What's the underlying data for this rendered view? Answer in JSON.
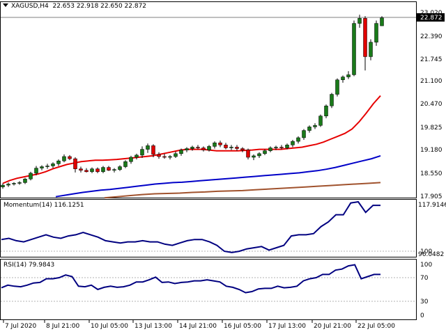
{
  "header": {
    "symbol": "XAGUSD,H4",
    "ohlc": "22.653 22.918 22.650 22.872"
  },
  "colors": {
    "bull": "#1a7a1a",
    "bear": "#e00000",
    "ma_fast": "#e60000",
    "ma_mid": "#0000c8",
    "ma_slow": "#a0522d",
    "momentum": "#000080",
    "rsi": "#000080",
    "level_line": "#c0c0c0",
    "current_price_bg": "#000000"
  },
  "main_panel": {
    "y_ticks": [
      "23.020",
      "22.390",
      "21.745",
      "21.100",
      "20.470",
      "19.825",
      "19.180",
      "18.550",
      "17.905"
    ],
    "current_price_label": "22.872"
  },
  "momentum_panel": {
    "label": "Momentum(14) 116.1251",
    "y_ticks": [
      "117.9146",
      "100",
      "96.0482"
    ]
  },
  "rsi_panel": {
    "label": "RSI(14) 79.9843",
    "y_ticks": [
      "100",
      "70",
      "30",
      "0"
    ]
  },
  "x_axis": {
    "labels": [
      "7 Jul 2020",
      "8 Jul 21:00",
      "10 Jul 05:00",
      "13 Jul 13:00",
      "14 Jul 21:00",
      "16 Jul 05:00",
      "17 Jul 13:00",
      "20 Jul 21:00",
      "22 Jul 05:00"
    ]
  },
  "chart_data": {
    "type": "line",
    "price_scale": [
      17.905,
      23.02
    ],
    "candles": [
      [
        18.2,
        18.3,
        18.15,
        18.25
      ],
      [
        18.25,
        18.32,
        18.2,
        18.28
      ],
      [
        18.28,
        18.33,
        18.24,
        18.3
      ],
      [
        18.3,
        18.36,
        18.26,
        18.32
      ],
      [
        18.32,
        18.45,
        18.28,
        18.42
      ],
      [
        18.42,
        18.62,
        18.38,
        18.58
      ],
      [
        18.58,
        18.78,
        18.52,
        18.72
      ],
      [
        18.72,
        18.8,
        18.66,
        18.76
      ],
      [
        18.76,
        18.84,
        18.7,
        18.78
      ],
      [
        18.78,
        18.88,
        18.72,
        18.84
      ],
      [
        18.84,
        18.96,
        18.78,
        18.92
      ],
      [
        18.92,
        19.1,
        18.88,
        19.04
      ],
      [
        19.04,
        19.08,
        18.94,
        18.98
      ],
      [
        18.98,
        19.02,
        18.6,
        18.7
      ],
      [
        18.7,
        18.76,
        18.6,
        18.66
      ],
      [
        18.66,
        18.72,
        18.6,
        18.62
      ],
      [
        18.62,
        18.74,
        18.58,
        18.7
      ],
      [
        18.7,
        18.74,
        18.58,
        18.62
      ],
      [
        18.62,
        18.78,
        18.58,
        18.74
      ],
      [
        18.74,
        18.78,
        18.64,
        18.66
      ],
      [
        18.66,
        18.72,
        18.6,
        18.68
      ],
      [
        18.68,
        18.8,
        18.64,
        18.76
      ],
      [
        18.76,
        18.94,
        18.72,
        18.9
      ],
      [
        18.9,
        19.06,
        18.84,
        19.02
      ],
      [
        19.02,
        19.12,
        18.96,
        19.08
      ],
      [
        19.08,
        19.32,
        19.0,
        19.24
      ],
      [
        19.24,
        19.4,
        19.14,
        19.34
      ],
      [
        19.34,
        19.38,
        19.02,
        19.1
      ],
      [
        19.1,
        19.16,
        18.98,
        19.04
      ],
      [
        19.04,
        19.12,
        18.98,
        19.02
      ],
      [
        19.02,
        19.08,
        18.96,
        19.04
      ],
      [
        19.04,
        19.18,
        19.0,
        19.12
      ],
      [
        19.12,
        19.26,
        19.06,
        19.22
      ],
      [
        19.22,
        19.3,
        19.16,
        19.26
      ],
      [
        19.26,
        19.34,
        19.2,
        19.3
      ],
      [
        19.3,
        19.36,
        19.24,
        19.28
      ],
      [
        19.28,
        19.32,
        19.18,
        19.22
      ],
      [
        19.22,
        19.36,
        19.18,
        19.32
      ],
      [
        19.32,
        19.46,
        19.26,
        19.42
      ],
      [
        19.42,
        19.48,
        19.3,
        19.36
      ],
      [
        19.36,
        19.42,
        19.24,
        19.28
      ],
      [
        19.28,
        19.36,
        19.22,
        19.3
      ],
      [
        19.3,
        19.36,
        19.2,
        19.26
      ],
      [
        19.26,
        19.3,
        19.16,
        19.22
      ],
      [
        19.22,
        19.26,
        18.96,
        19.02
      ],
      [
        19.02,
        19.1,
        18.94,
        19.06
      ],
      [
        19.06,
        19.16,
        19.0,
        19.12
      ],
      [
        19.12,
        19.24,
        19.08,
        19.2
      ],
      [
        19.2,
        19.32,
        19.16,
        19.28
      ],
      [
        19.28,
        19.34,
        19.22,
        19.3
      ],
      [
        19.3,
        19.36,
        19.24,
        19.28
      ],
      [
        19.28,
        19.4,
        19.24,
        19.36
      ],
      [
        19.36,
        19.5,
        19.3,
        19.46
      ],
      [
        19.46,
        19.6,
        19.4,
        19.56
      ],
      [
        19.56,
        19.8,
        19.5,
        19.76
      ],
      [
        19.76,
        19.9,
        19.7,
        19.86
      ],
      [
        19.86,
        19.96,
        19.8,
        19.9
      ],
      [
        19.9,
        20.2,
        19.86,
        20.16
      ],
      [
        20.16,
        20.48,
        20.1,
        20.44
      ],
      [
        20.44,
        20.8,
        20.38,
        20.76
      ],
      [
        20.76,
        21.2,
        20.7,
        21.16
      ],
      [
        21.16,
        21.28,
        21.08,
        21.24
      ],
      [
        21.24,
        21.4,
        21.18,
        21.3
      ],
      [
        21.3,
        22.8,
        21.26,
        22.72
      ],
      [
        22.72,
        22.96,
        22.6,
        22.86
      ],
      [
        22.86,
        22.92,
        21.42,
        21.8
      ],
      [
        21.8,
        22.28,
        21.7,
        22.2
      ],
      [
        22.2,
        22.8,
        22.1,
        22.72
      ],
      [
        22.653,
        22.918,
        22.65,
        22.872
      ]
    ],
    "ma_fast": [
      18.3,
      18.38,
      18.44,
      18.48,
      18.52,
      18.56,
      18.62,
      18.7,
      18.76,
      18.82,
      18.86,
      18.9,
      18.92,
      18.94,
      18.94,
      18.95,
      18.96,
      18.98,
      19.0,
      19.02,
      19.04,
      19.06,
      19.1,
      19.14,
      19.18,
      19.22,
      19.24,
      19.24,
      19.24,
      19.22,
      19.2,
      19.2,
      19.2,
      19.2,
      19.21,
      19.22,
      19.24,
      19.24,
      19.24,
      19.24,
      19.26,
      19.28,
      19.3,
      19.34,
      19.38,
      19.44,
      19.52,
      19.6,
      19.68,
      19.8,
      20.0,
      20.24,
      20.5,
      20.72
    ],
    "ma_mid": [
      17.93,
      17.97,
      18.01,
      18.05,
      18.08,
      18.11,
      18.13,
      18.16,
      18.19,
      18.22,
      18.25,
      18.28,
      18.3,
      18.32,
      18.33,
      18.35,
      18.37,
      18.39,
      18.41,
      18.43,
      18.45,
      18.47,
      18.49,
      18.51,
      18.53,
      18.55,
      18.57,
      18.59,
      18.62,
      18.65,
      18.69,
      18.74,
      18.8,
      18.86,
      18.92,
      18.98,
      19.06
    ],
    "ma_slow": [
      17.9,
      17.93,
      17.96,
      17.99,
      18.01,
      18.02,
      18.03,
      18.05,
      18.06,
      18.08,
      18.09,
      18.1,
      18.12,
      18.14,
      18.16,
      18.18,
      18.2,
      18.22,
      18.24,
      18.26,
      18.28,
      18.3,
      18.32
    ],
    "momentum": [
      102.5,
      103,
      102,
      101.5,
      102.5,
      103.5,
      104.5,
      103.5,
      103,
      104,
      104.5,
      105.5,
      104.5,
      103.5,
      102,
      101.5,
      101,
      101.5,
      101.5,
      102,
      101.5,
      101.5,
      100.5,
      100,
      101,
      102,
      102.5,
      102.5,
      101.5,
      100,
      97.5,
      97,
      97.5,
      98.5,
      99,
      99.5,
      98,
      99,
      100,
      104,
      104.5,
      104.5,
      105,
      108,
      110,
      113,
      113,
      118,
      118.5,
      114,
      117,
      117
    ],
    "rsi": [
      55,
      60,
      58,
      57,
      60,
      64,
      65,
      72,
      72,
      74,
      79,
      76,
      58,
      57,
      60,
      52,
      56,
      58,
      56,
      57,
      60,
      66,
      66,
      70,
      75,
      65,
      66,
      63,
      65,
      66,
      68,
      68,
      70,
      68,
      66,
      58,
      56,
      52,
      46,
      48,
      53,
      54,
      54,
      58,
      55,
      56,
      58,
      68,
      72,
      74,
      80,
      80,
      88,
      90,
      96,
      98,
      72,
      76,
      80,
      80
    ],
    "momentum_range": [
      96.0482,
      117.9146
    ],
    "rsi_range": [
      0,
      100
    ]
  }
}
